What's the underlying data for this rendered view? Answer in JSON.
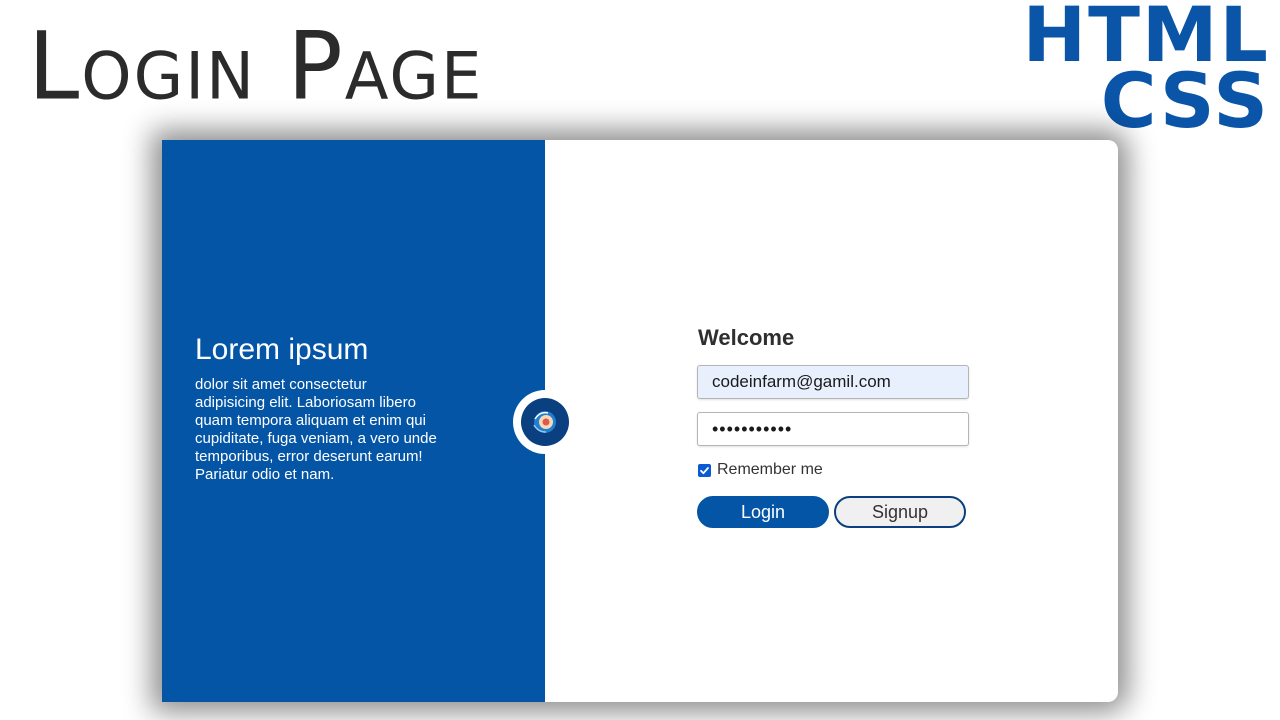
{
  "header": {
    "title": "Login Page",
    "tech_line1": "HTML",
    "tech_line2": "CSS"
  },
  "left_panel": {
    "heading": "Lorem ipsum",
    "text": "dolor sit amet consectetur adipisicing elit. Laboriosam libero quam tempora aliquam et enim qui cupiditate, fuga veniam, a vero unde temporibus, error deserunt earum! Pariatur odio et nam.",
    "badge_icon": "avatar-logo-icon"
  },
  "form": {
    "welcome": "Welcome",
    "email_value": "codeinfarm@gamil.com",
    "password_value": "•••••••••••",
    "remember_label": "Remember me",
    "remember_checked": true,
    "login_label": "Login",
    "signup_label": "Signup"
  },
  "colors": {
    "brand_blue": "#0555a6",
    "autofill_bg": "#e8f0fe",
    "title_text": "#2b2b2b"
  }
}
